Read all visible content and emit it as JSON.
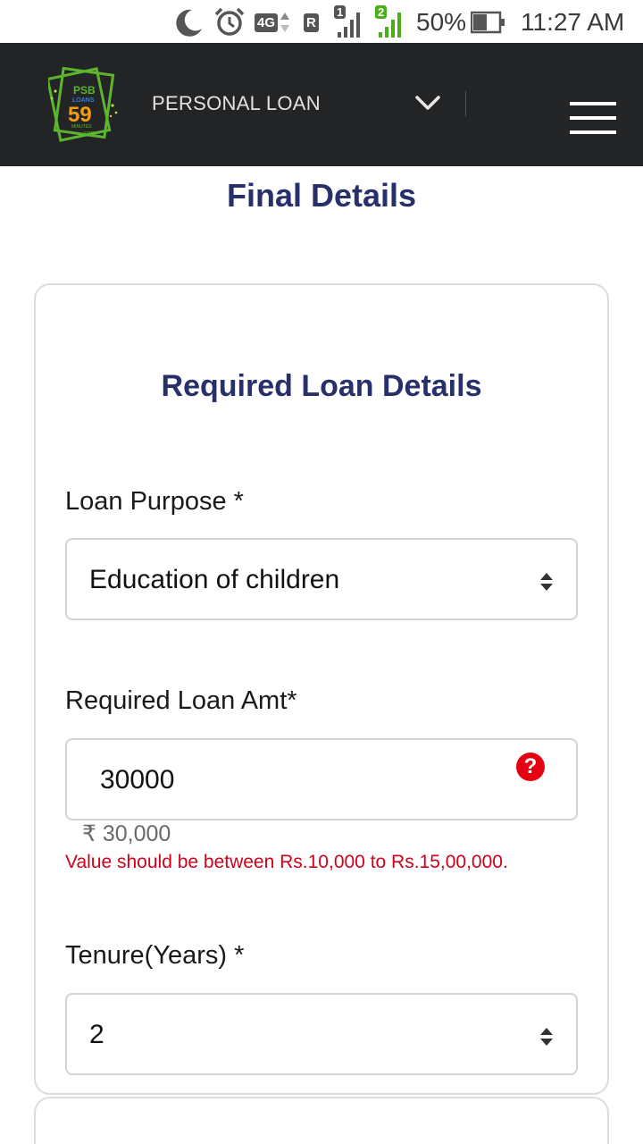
{
  "status_bar": {
    "network_type": "4G",
    "roaming_badge": "R",
    "sim1_label": "1",
    "sim2_label": "2",
    "battery_percent": "50%",
    "time": "11:27 AM",
    "icons": [
      "moon-icon",
      "alarm-icon",
      "network-4g-icon",
      "roaming-icon",
      "signal-sim1-icon",
      "signal-sim2-icon",
      "battery-icon"
    ]
  },
  "header": {
    "logo": {
      "line1": "PSB",
      "line2": "LOANS",
      "line3": "59",
      "line4": "MINUTES",
      "line5": ".com"
    },
    "title": "PERSONAL LOAN",
    "background_color": "#232425"
  },
  "page": {
    "title": "Final Details",
    "title_color": "#28306b"
  },
  "form": {
    "section_title": "Required Loan Details",
    "loan_purpose": {
      "label": "Loan Purpose *",
      "selected_value": "Education of children"
    },
    "loan_amount": {
      "label": "Required Loan Amt*",
      "value": "30000",
      "help_icon": "?",
      "amount_in_rupees": "₹ 30,000",
      "error": "Value should be between Rs.10,000 to Rs.15,00,000."
    },
    "tenure": {
      "label": "Tenure(Years) *",
      "selected_value": "2"
    }
  },
  "colors": {
    "error": "#d0021b",
    "help_icon": "#e60012",
    "accent_green": "#4caf1a"
  }
}
